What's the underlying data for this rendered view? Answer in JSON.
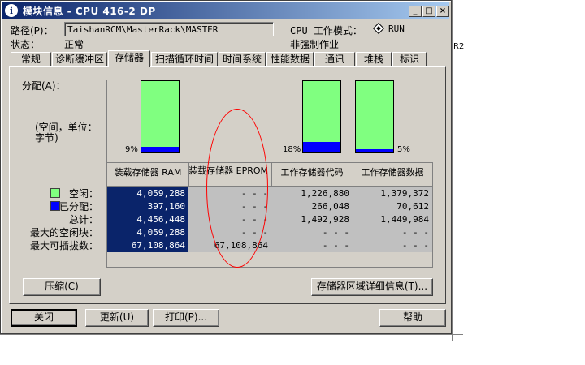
{
  "window": {
    "title": "模块信息 - CPU 416-2 DP",
    "icon": "info-icon"
  },
  "header": {
    "path_label": "路径(P)：",
    "path_value": "TaishanRCM\\MasterRack\\MASTER",
    "status_label": "状态：",
    "status_value": "正常",
    "mode_label": "CPU 工作模式：",
    "mode_value": "RUN",
    "mode_sub": "非强制作业"
  },
  "tabs": [
    "常规",
    "诊断缓冲区",
    "存储器",
    "扫描循环时间",
    "时间系统",
    "性能数据",
    "通讯",
    "堆栈",
    "标识"
  ],
  "active_tab": "存储器",
  "memory": {
    "alloc_label": "分配(A)：",
    "unit_label": "(空间，单位：字节)",
    "bars": [
      {
        "name": "ram",
        "used_pct": 9,
        "label": "9%"
      },
      {
        "name": "work-code",
        "used_pct": 18,
        "label": "18%"
      },
      {
        "name": "work-data",
        "used_pct": 5,
        "label": "5%"
      }
    ],
    "columns": [
      "装载存储器 RAM",
      "装载存储器 EPROM",
      "工作存储器代码",
      "工作存储器数据"
    ],
    "rows": [
      {
        "label": "空闲：",
        "values": [
          "4,059,288",
          "- - -",
          "1,226,880",
          "1,379,372"
        ]
      },
      {
        "label": "已分配：",
        "values": [
          "397,160",
          "- - -",
          "266,048",
          "70,612"
        ]
      },
      {
        "label": "总计：",
        "values": [
          "4,456,448",
          "- - -",
          "1,492,928",
          "1,449,984"
        ]
      },
      {
        "label": "最大的空闲块：",
        "values": [
          "4,059,288",
          "- - -",
          "- - -",
          "- - -"
        ]
      },
      {
        "label": "最大可插拔数：",
        "values": [
          "67,108,864",
          "67,108,864",
          "- - -",
          "- - -"
        ]
      }
    ],
    "legend_free_color": "#80ff80",
    "legend_alloc_color": "#0000ff",
    "compress_button": "压缩(C)",
    "details_button": "存储器区域详细信息(T)..."
  },
  "footer": {
    "close": "关闭",
    "refresh": "更新(U)",
    "print": "打印(P)...",
    "help": "帮助"
  },
  "background": {
    "edge_text": "R2"
  }
}
